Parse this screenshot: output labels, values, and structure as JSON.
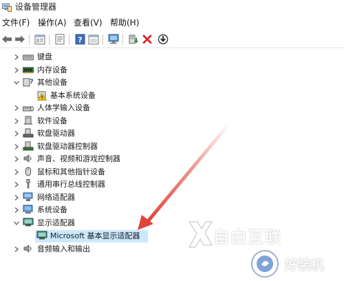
{
  "window": {
    "title": "设备管理器",
    "icon": "device-manager-icon"
  },
  "menu": [
    {
      "label": "文件(F)"
    },
    {
      "label": "操作(A)"
    },
    {
      "label": "查看(V)"
    },
    {
      "label": "帮助(H)"
    }
  ],
  "toolbar": [
    {
      "name": "back-icon"
    },
    {
      "name": "forward-icon"
    },
    {
      "name": "show-hide-console-tree-icon"
    },
    {
      "name": "properties-icon"
    },
    {
      "name": "help-icon"
    },
    {
      "name": "details-icon"
    },
    {
      "name": "monitor-icon"
    },
    {
      "name": "update-driver-icon"
    },
    {
      "name": "uninstall-icon"
    },
    {
      "name": "scan-download-icon"
    }
  ],
  "tree": [
    {
      "label": "键盘",
      "expanded": false,
      "icon": "keyboard-icon"
    },
    {
      "label": "内存设备",
      "expanded": false,
      "icon": "memory-device-icon"
    },
    {
      "label": "其他设备",
      "expanded": true,
      "icon": "unknown-device-icon"
    },
    {
      "label": "基本系统设备",
      "child": true,
      "icon": "warning-device-icon"
    },
    {
      "label": "人体学输入设备",
      "expanded": false,
      "icon": "hid-icon"
    },
    {
      "label": "软件设备",
      "expanded": false,
      "icon": "software-device-icon"
    },
    {
      "label": "软盘驱动器",
      "expanded": false,
      "icon": "floppy-drive-icon"
    },
    {
      "label": "软盘驱动器控制器",
      "expanded": false,
      "icon": "floppy-controller-icon"
    },
    {
      "label": "声音、视频和游戏控制器",
      "expanded": false,
      "icon": "sound-icon"
    },
    {
      "label": "鼠标和其他指针设备",
      "expanded": false,
      "icon": "mouse-icon"
    },
    {
      "label": "通用串行总线控制器",
      "expanded": false,
      "icon": "usb-icon"
    },
    {
      "label": "网络适配器",
      "expanded": false,
      "icon": "network-adapter-icon"
    },
    {
      "label": "系统设备",
      "expanded": false,
      "icon": "system-device-icon"
    },
    {
      "label": "显示适配器",
      "expanded": true,
      "icon": "display-adapter-icon"
    },
    {
      "label": "Microsoft 基本显示适配器",
      "child": true,
      "selected": true,
      "icon": "display-device-icon"
    },
    {
      "label": "音频输入和输出",
      "expanded": false,
      "icon": "audio-io-icon"
    }
  ],
  "watermark": {
    "brand": "自由互联",
    "site": "好装机"
  },
  "colors": {
    "selection": "#cce8ff",
    "arrow": "#e0443a",
    "uninstall": "#d8262b",
    "driver_green": "#2e8b3a"
  }
}
